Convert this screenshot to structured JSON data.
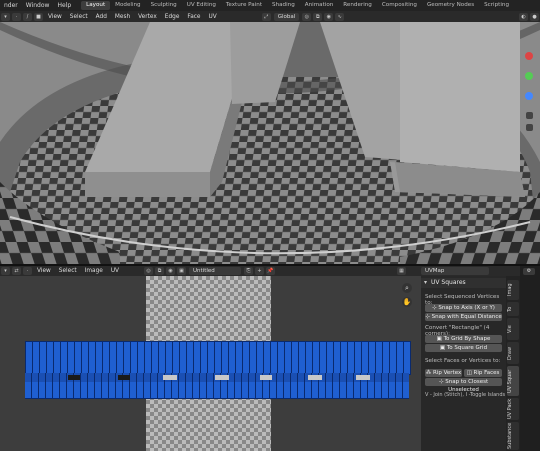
{
  "topbar": {
    "menus": [
      "nder",
      "Window",
      "Help"
    ],
    "workspaces": [
      "Layout",
      "Modeling",
      "Sculpting",
      "UV Editing",
      "Texture Paint",
      "Shading",
      "Animation",
      "Rendering",
      "Compositing",
      "Geometry Nodes",
      "Scripting"
    ],
    "active_workspace": "Layout"
  },
  "viewport_header": {
    "menus": [
      "View",
      "Select",
      "Add",
      "Mesh",
      "Vertex",
      "Edge",
      "Face",
      "UV"
    ],
    "orientation": "Global"
  },
  "uv_header": {
    "menus": [
      "View",
      "Select",
      "Image",
      "UV"
    ],
    "image_name": "Untitled",
    "uvmap": "UVMap"
  },
  "panel": {
    "title": "UV Squares",
    "section1": "Select Sequenced Vertices to:",
    "snap_axis": "Snap to Axis (X or Y)",
    "snap_equal": "Snap with Equal Distance",
    "section2": "Convert \"Rectangle\" (4 corners):",
    "grid_shape": "To Grid By Shape",
    "square_grid": "To Square Grid",
    "section3": "Select Faces or Vertices to:",
    "rip_vertex": "Rip Vertex",
    "rip_faces": "Rip Faces",
    "snap_closest": "Snap to Closest Unselected",
    "hint": "V - Join (Stitch), I -Toggle Islands"
  },
  "tabs": [
    "Imag",
    "To",
    "Vie",
    "Draw",
    "UV Squar",
    "UV Pack",
    "Substance"
  ],
  "active_tab": "UV Squar",
  "colors": {
    "uv_blue": "#1f5fd1",
    "uv_blue_edge": "#0a2a6e",
    "header_bg": "#2a2a2a",
    "panel_bg": "#282828"
  }
}
